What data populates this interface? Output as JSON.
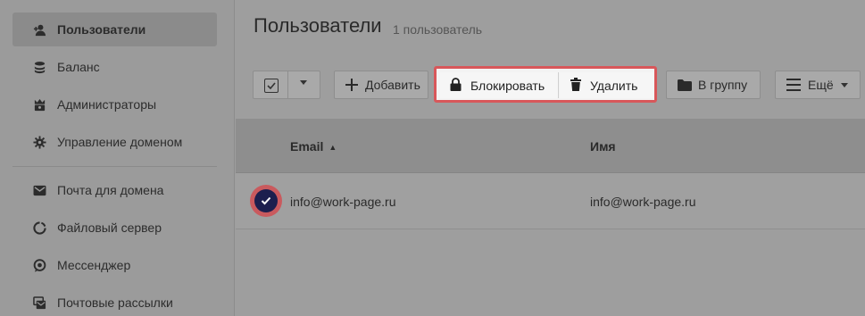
{
  "sidebar": {
    "items": [
      {
        "label": "Пользователи",
        "icon": "user-icon",
        "active": true
      },
      {
        "label": "Баланс",
        "icon": "coins-icon"
      },
      {
        "label": "Администраторы",
        "icon": "admins-icon"
      },
      {
        "label": "Управление доменом",
        "icon": "gear-icon"
      },
      {
        "label": "Почта для домена",
        "icon": "mail-icon"
      },
      {
        "label": "Файловый сервер",
        "icon": "file-server-icon"
      },
      {
        "label": "Мессенджер",
        "icon": "chat-icon"
      },
      {
        "label": "Почтовые рассылки",
        "icon": "mailing-icon"
      }
    ]
  },
  "header": {
    "title": "Пользователи",
    "subtitle": "1 пользователь"
  },
  "toolbar": {
    "add_label": "Добавить",
    "block_label": "Блокировать",
    "delete_label": "Удалить",
    "group_label": "В группу",
    "more_label": "Ещё"
  },
  "table": {
    "columns": [
      "Email",
      "Имя"
    ],
    "rows": [
      {
        "email": "info@work-page.ru",
        "name": "info@work-page.ru",
        "selected": true
      }
    ]
  },
  "colors": {
    "highlight": "#d8575a",
    "check_selected": "#1c1f4e"
  }
}
